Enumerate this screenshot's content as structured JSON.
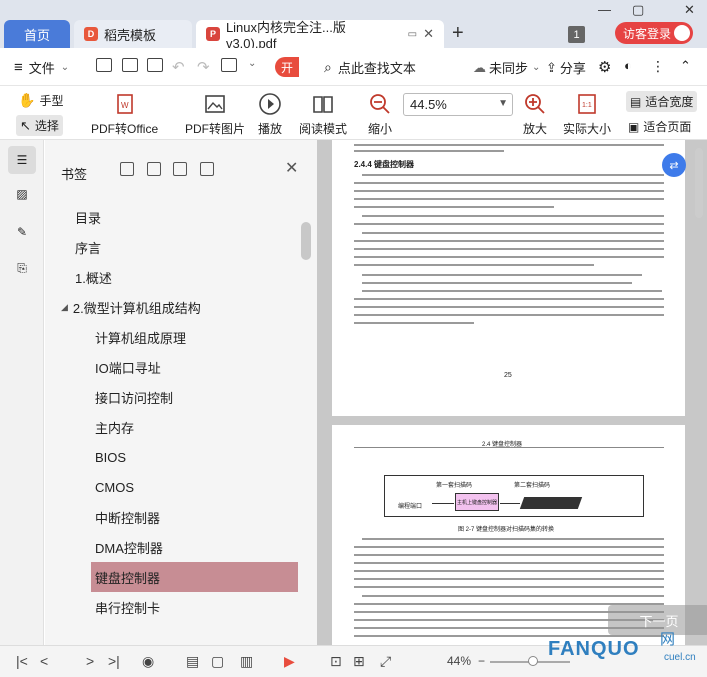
{
  "tabs": {
    "home": "首页",
    "template": "稻壳模板",
    "document": "Linux内核完全注...版v3.0).pdf",
    "window_count": "1",
    "login": "访客登录"
  },
  "menu": {
    "file": "文件",
    "open": "开",
    "search_placeholder": "点此查找文本",
    "sync": "未同步",
    "share": "分享"
  },
  "ribbon": {
    "hand": "手型",
    "select": "选择",
    "pdf_to_office": "PDF转Office",
    "pdf_to_image": "PDF转图片",
    "play": "播放",
    "read_mode": "阅读模式",
    "zoom_out": "缩小",
    "zoom_value": "44.5%",
    "zoom_in": "放大",
    "actual_size": "实际大小",
    "fit_width": "适合宽度",
    "fit_page": "适合页面"
  },
  "bookmarks": {
    "title": "书签",
    "items": [
      {
        "label": "目录",
        "level": 0
      },
      {
        "label": "序言",
        "level": 0
      },
      {
        "label": "1.概述",
        "level": 0
      },
      {
        "label": "2.微型计算机组成结构",
        "level": 0,
        "expanded": true
      },
      {
        "label": "计算机组成原理",
        "level": 1
      },
      {
        "label": "IO端口寻址",
        "level": 1
      },
      {
        "label": "接口访问控制",
        "level": 1
      },
      {
        "label": "主内存",
        "level": 1
      },
      {
        "label": "BIOS",
        "level": 1
      },
      {
        "label": "CMOS",
        "level": 1
      },
      {
        "label": "中断控制器",
        "level": 1
      },
      {
        "label": "DMA控制器",
        "level": 1
      },
      {
        "label": "键盘控制器",
        "level": 1,
        "selected": true
      },
      {
        "label": "串行控制卡",
        "level": 1
      }
    ]
  },
  "document": {
    "page1_heading": "2.4.4 键盘控制器",
    "page1_number": "25",
    "page2_header": "2.4 键盘控制器",
    "figure_label_1": "第一套扫描码",
    "figure_label_2": "第二套扫描码",
    "figure_box": "主机上键盘控制器",
    "figure_left": "编程端口",
    "figure_caption": "图 2-7 键盘控制器对扫描码集的转换"
  },
  "status": {
    "zoom": "44%"
  },
  "overlay": {
    "next_page": "下一页",
    "watermark": "FANQUO",
    "watermark_cn": "网",
    "watermark_domain": "cuel.cn"
  },
  "colors": {
    "home_tab": "#4a7bd9",
    "accent_red": "#e64343",
    "selected_bookmark": "#c78d94"
  }
}
